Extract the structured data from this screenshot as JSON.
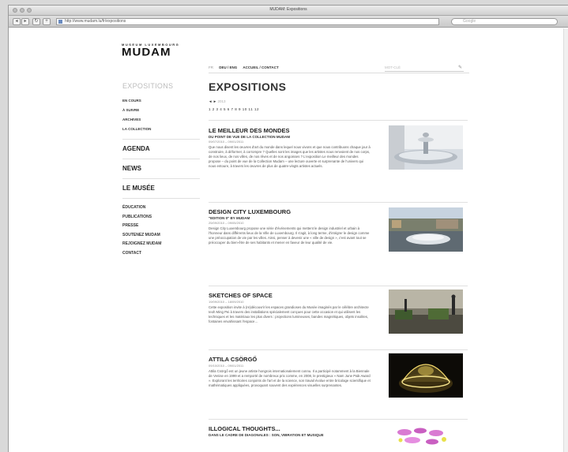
{
  "window": {
    "title": "MUDAM: Expositions",
    "url": "http://www.mudam.lu/fr/expositions",
    "search_placeholder": "Google"
  },
  "site": {
    "logo_tag": "MUSEUM LUXEMBOURG",
    "logo_word": "MUDAM",
    "lang": "FR",
    "lang_links": "DEU / ENG",
    "top_links": "ACCUEIL / CONTACT",
    "search_placeholder": "MOT-CLÉ"
  },
  "sidebar": {
    "heading": "EXPOSITIONS",
    "sub": [
      "EN COURS",
      "À SUIVRE",
      "ARCHIVES",
      "LA COLLECTION"
    ],
    "sections": [
      "AGENDA",
      "NEWS",
      "LE MUSÉE"
    ],
    "links": [
      "ÉDUCATION",
      "PUBLICATIONS",
      "PRESSE",
      "SOUTENEZ MUDAM",
      "REJOIGNEZ MUDAM",
      "CONTACT"
    ]
  },
  "main": {
    "heading": "EXPOSITIONS",
    "pager_arrows": "◄ ►",
    "pager_label": "2013",
    "pages": "1 2 3 4 5 6 7 8 9 10 11 12",
    "entries": [
      {
        "title": "LE MEILLEUR DES MONDES",
        "subtitle": "DU POINT DE VUE DE LA COLLECTION MUDAM",
        "date": "09/07/2010 – 09/01/2011",
        "text": "Que nous disent les œuvres d'art du monde dans lequel nous vivons et que nous contribuons chaque jour à construire, à déformer, à corrompre ? Quelles sont les images que les artistes nous renvoient de nos corps, de nos lieux, de nos villes, de nos rêves et de nos angoisses ? L'exposition Le meilleur des mondes propose – du point de vue de la Collection Mudam – une lecture ouverte et surprenante de l'univers qui nous entoure, à travers les œuvres de plus de quatre-vingts artistes actuels."
      },
      {
        "title": "DESIGN CITY LUXEMBOURG",
        "subtitle": "\"EDITION 0\" BY MUDAM",
        "date": "25/09/2010 – 09/05/2010",
        "text": "Design City Luxembourg propose une série d'événements qui mettent le design industriel et urbain à l'honneur dans différents lieux de la Ville de Luxembourg. Il s'agit, à long terme, d'intégrer le design comme une préoccupation de vie par les villes. Ainsi, penser à devenir une « ville de design », c'est avant tout se préoccuper du bien-être de ses habitants et mener en faveur de leur qualité de vie."
      },
      {
        "title": "SKETCHES OF SPACE",
        "subtitle": "",
        "date": "19/09/2010 – 18/09/2010",
        "text": "Cette exposition invite à (re)découvrir les espaces grandioses du Musée imaginés par le célèbre architecte Ieoh Ming Pei à travers des installations spécialement conçues pour cette occasion et qui utilisent les techniques et les matériaux les plus divers : projections lumineuses, bandes magnétiques, objets insolites, fontaines envahissant l'espace…"
      },
      {
        "title": "ATTILA CSÖRGŐ",
        "subtitle": "",
        "date": "09/10/2010 – 09/01/2011",
        "text": "Attila Csörgő est un jeune artiste hongrois internationalement connu. Il a participé notamment à la Biennale de Venise en 1999 et a remporté de nombreux prix comme, en 2008, le prestigieux « Nam June Paik Award ». Explorant les territoires conjoints de l'art et de la science, son travail évolue entre bricolage scientifique et mathématiques appliquées, provoquant souvent des expériences visuelles surprenantes."
      },
      {
        "title": "ILLOGICAL THOUGHTS...",
        "subtitle": "DANS LE CADRE DE DIAGONALES : SON, VIBRATION ET MUSIQUE",
        "date": "",
        "text": ""
      }
    ]
  }
}
